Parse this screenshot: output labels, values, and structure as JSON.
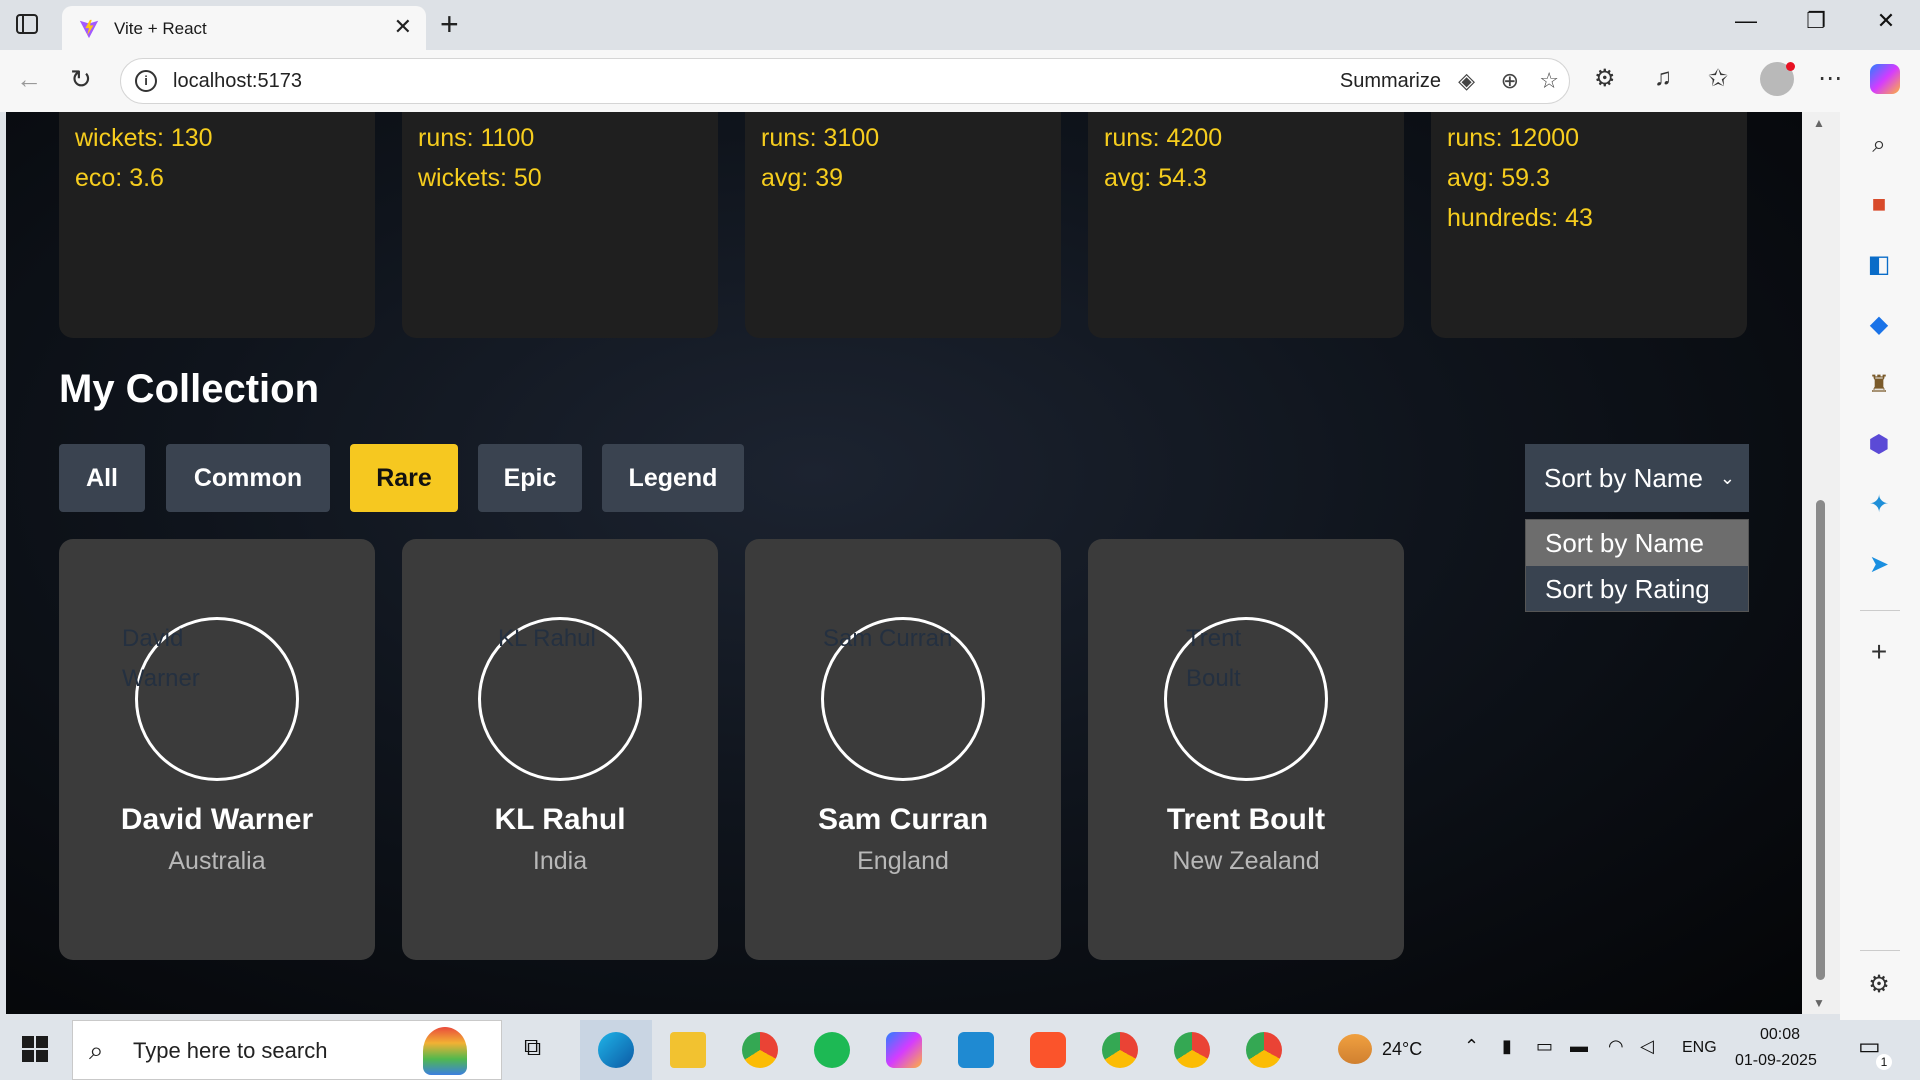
{
  "browser": {
    "tab_title": "Vite + React",
    "url": "localhost:5173",
    "summarize_label": "Summarize"
  },
  "top_cards": [
    {
      "stats": [
        "wickets: 130",
        "eco: 3.6"
      ]
    },
    {
      "stats": [
        "runs: 1100",
        "wickets: 50"
      ]
    },
    {
      "stats": [
        "runs: 3100",
        "avg: 39"
      ]
    },
    {
      "stats": [
        "runs: 4200",
        "avg: 54.3"
      ]
    },
    {
      "stats": [
        "runs: 12000",
        "avg: 59.3",
        "hundreds: 43"
      ]
    }
  ],
  "collection": {
    "title": "My Collection",
    "filters": [
      "All",
      "Common",
      "Rare",
      "Epic",
      "Legend"
    ],
    "active_filter": "Rare",
    "sort": {
      "selected": "Sort by Name",
      "options": [
        "Sort by Name",
        "Sort by Rating"
      ]
    },
    "players": [
      {
        "name": "David Warner",
        "country": "Australia",
        "alt": "David Warner"
      },
      {
        "name": "KL Rahul",
        "country": "India",
        "alt": "KL Rahul"
      },
      {
        "name": "Sam Curran",
        "country": "England",
        "alt": "Sam Curran"
      },
      {
        "name": "Trent Boult",
        "country": "New Zealand",
        "alt": "Trent Boult"
      }
    ]
  },
  "taskbar": {
    "search_placeholder": "Type here to search",
    "temperature": "24°C",
    "language": "ENG",
    "time": "00:08",
    "date": "01-09-2025",
    "notification_count": "1"
  },
  "colors": {
    "accent": "#f6c820",
    "stat_text": "#f6cd1e",
    "filter_bg": "#3a4350",
    "card_bg": "#3b3b3b"
  }
}
